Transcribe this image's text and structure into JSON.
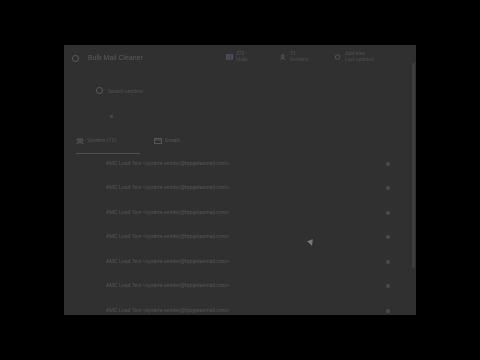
{
  "window": {
    "title": "Bulk Mail Cleaner"
  },
  "stats": [
    {
      "icon": "mail-icon",
      "value": "372",
      "label": "Mails"
    },
    {
      "icon": "users-icon",
      "value": "71",
      "label": "Senders"
    },
    {
      "icon": "clock-icon",
      "value": "Just now",
      "label": "Last updated"
    }
  ],
  "search": {
    "placeholder": "Search senders"
  },
  "tabs": [
    {
      "icon": "group-icon",
      "label": "Senders (71)"
    },
    {
      "icon": "calendar-icon",
      "label": "Emails"
    }
  ],
  "rows": [
    {
      "email": "AMC Load Test <system-sender@fppgetaemail.com>"
    },
    {
      "email": "AMC Load Test <system-sender@fppgetaemail.com>"
    },
    {
      "email": "AMC Load Test <system-sender@fppgetaemail.com>"
    },
    {
      "email": "AMC Load Test <system-sender@fppgetaemail.com>"
    },
    {
      "email": "AMC Load Test <system-sender@fppgetaemail.com>"
    },
    {
      "email": "AMC Load Test <system-sender@fppgetaemail.com>"
    },
    {
      "email": "AMC Load Test <system-sender@fppgetaemail.com>"
    }
  ]
}
